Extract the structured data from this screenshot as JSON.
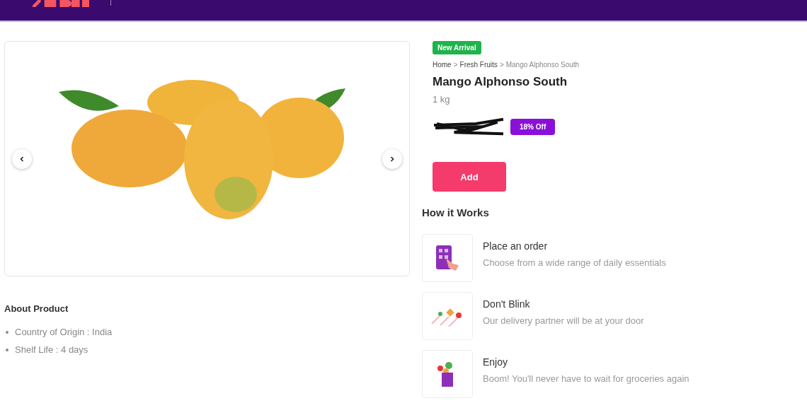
{
  "product": {
    "badge": "New Arrival",
    "breadcrumb": {
      "separator": ">",
      "items": [
        "Home",
        "Fresh Fruits",
        "Mango Alphonso South"
      ]
    },
    "name": "Mango Alphonso South",
    "quantity": "1 kg",
    "discount": "18% Off",
    "add_button": "Add"
  },
  "how_it_works": {
    "title": "How it Works",
    "steps": [
      {
        "kind": "order",
        "title": "Place an order",
        "description": "Choose from a wide range of daily essentials"
      },
      {
        "kind": "delivery",
        "title": "Don't Blink",
        "description": "Our delivery partner will be at your door"
      },
      {
        "kind": "enjoy",
        "title": "Enjoy",
        "description": "Boom! You'll never have to wait for groceries again"
      }
    ]
  },
  "about": {
    "title": "About Product",
    "items": [
      "Country of Origin : India",
      "Shelf Life : 4 days"
    ]
  }
}
